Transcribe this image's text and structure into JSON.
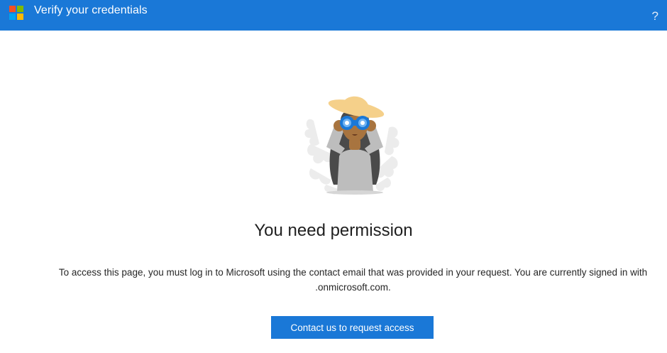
{
  "header": {
    "title": "Verify your credentials",
    "logo_icon": "microsoft-logo-icon",
    "help_icon": "question-mark-icon",
    "help_symbol": "?",
    "background_color": "#1a78d7"
  },
  "main": {
    "illustration_icon": "woman-with-binoculars-icon",
    "title": "You need permission",
    "message_line1": "To access this page, you must log in to Microsoft using the contact email that was provided in your request. You are currently signed in with",
    "message_line2": ".onmicrosoft.com.",
    "cta_label": "Contact us to request access"
  },
  "colors": {
    "accent": "#1a78d7",
    "logo_red": "#f25022",
    "logo_green": "#7fba00",
    "logo_blue": "#00a4ef",
    "logo_yellow": "#ffb900"
  }
}
